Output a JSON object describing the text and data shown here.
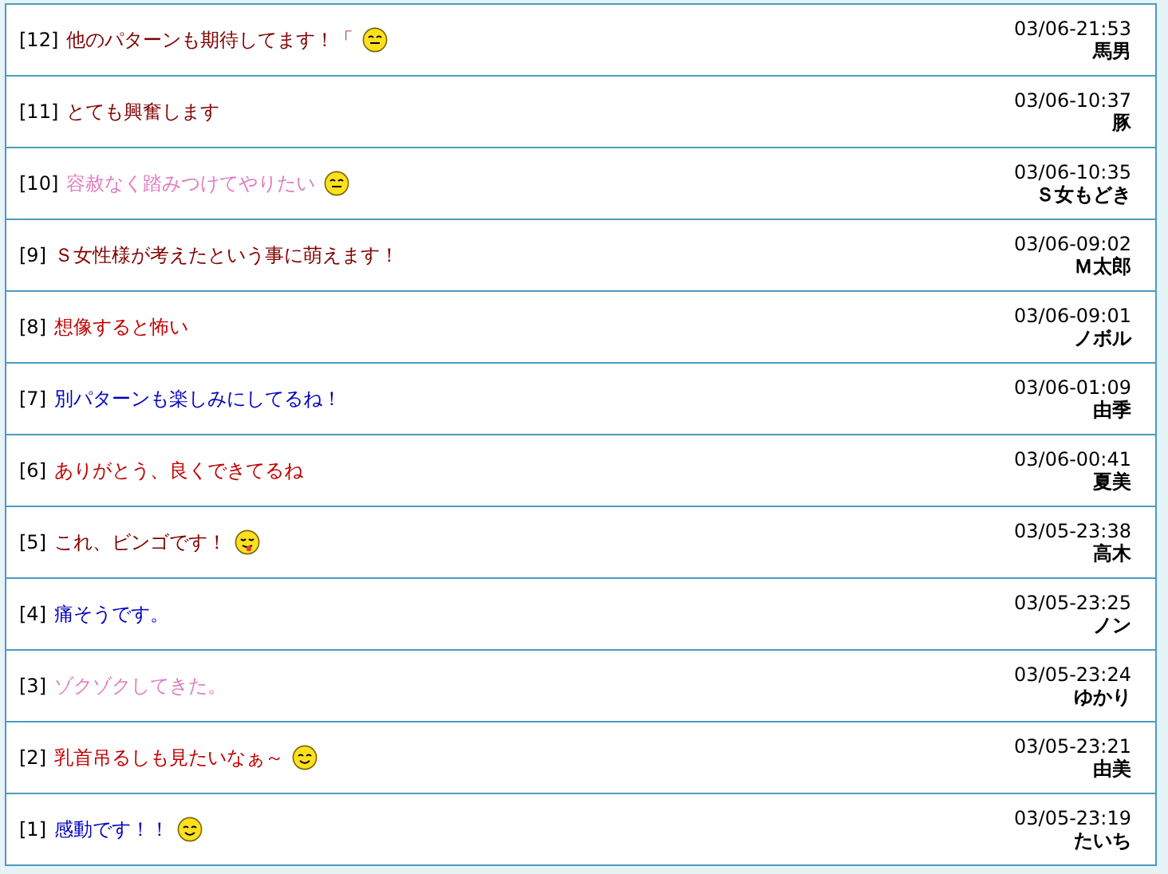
{
  "comments": [
    {
      "number": "[12]",
      "text": "他のパターンも期待してます！「",
      "color": "#800000",
      "emoticon": {
        "kind": "grin"
      },
      "date": "03/06-21:53",
      "author": "馬男"
    },
    {
      "number": "[11]",
      "text": "とても興奮します",
      "color": "#800000",
      "date": "03/06-10:37",
      "author": "豚"
    },
    {
      "number": "[10]",
      "text": "容赦なく踏みつけてやりたい",
      "color": "#e07ec0",
      "emoticon": {
        "kind": "grin"
      },
      "date": "03/06-10:35",
      "author": "Ｓ女もどき"
    },
    {
      "number": "[9]",
      "text": "Ｓ女性様が考えたという事に萌えます！",
      "color": "#800000",
      "date": "03/06-09:02",
      "author": "Ｍ太郎"
    },
    {
      "number": "[8]",
      "text": "想像すると怖い",
      "color": "#c00000",
      "date": "03/06-09:01",
      "author": "ノボル"
    },
    {
      "number": "[7]",
      "text": "別パターンも楽しみにしてるね！",
      "color": "#0000c0",
      "date": "03/06-01:09",
      "author": "由季"
    },
    {
      "number": "[6]",
      "text": "ありがとう、良くできてるね",
      "color": "#c00000",
      "date": "03/06-00:41",
      "author": "夏美"
    },
    {
      "number": "[5]",
      "text": "これ、ビンゴです！",
      "color": "#800000",
      "emoticon": {
        "kind": "tongue"
      },
      "date": "03/05-23:38",
      "author": "高木"
    },
    {
      "number": "[4]",
      "text": "痛そうです。",
      "color": "#0000c0",
      "date": "03/05-23:25",
      "author": "ノン"
    },
    {
      "number": "[3]",
      "text": "ゾクゾクしてきた。",
      "color": "#e07ec0",
      "date": "03/05-23:24",
      "author": "ゆかり"
    },
    {
      "number": "[2]",
      "text": "乳首吊るしも見たいなぁ～",
      "color": "#c00000",
      "emoticon": {
        "kind": "smile"
      },
      "date": "03/05-23:21",
      "author": "由美"
    },
    {
      "number": "[1]",
      "text": "感動です！！",
      "color": "#0000c0",
      "emoticon": {
        "kind": "smile"
      },
      "date": "03/05-23:19",
      "author": "たいち"
    }
  ]
}
